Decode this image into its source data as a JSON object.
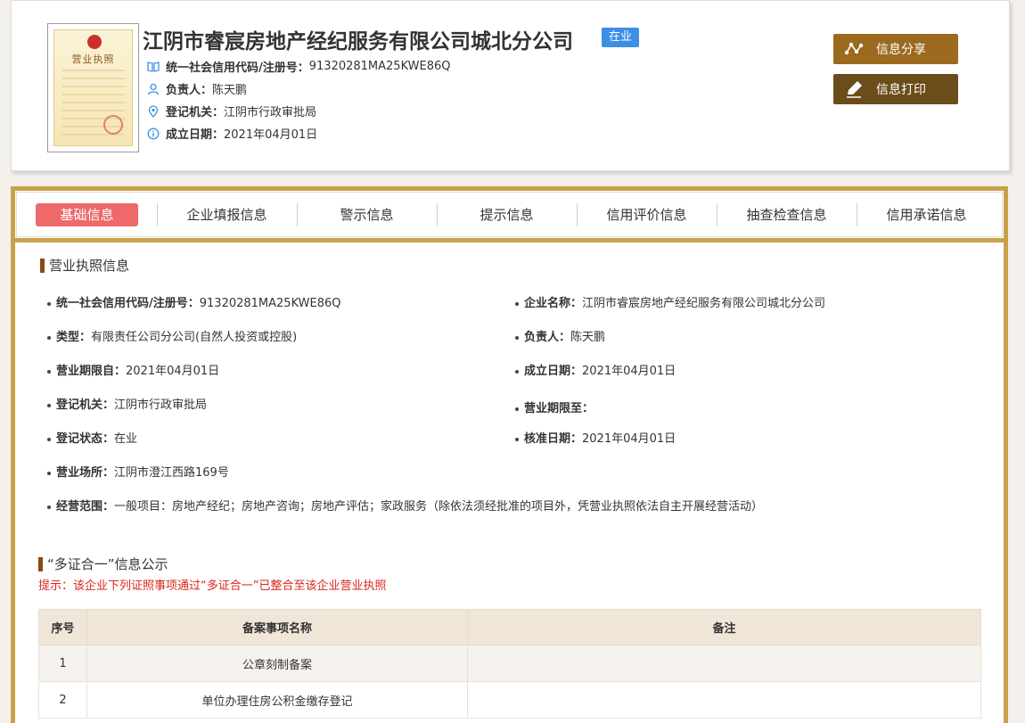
{
  "header": {
    "license_title": "营业执照",
    "company_name": "江阴市睿宸房地产经纪服务有限公司城北分公司",
    "status": "在业",
    "credit_code_label": "统一社会信用代码/注册号：",
    "credit_code": "91320281MA25KWE86Q",
    "legal_rep_label": "负责人：",
    "legal_rep": "陈天鹏",
    "authority_label": "登记机关：",
    "authority": "江阴市行政审批局",
    "established_label": "成立日期：",
    "established": "2021年04月01日",
    "share_label": "信息分享",
    "print_label": "信息打印",
    "accent_colors": {
      "share": "#9b6a1f",
      "print": "#6b4c1b",
      "status": "#3e8ee6"
    }
  },
  "tabs": [
    {
      "label": "基础信息",
      "active": true
    },
    {
      "label": "企业填报信息"
    },
    {
      "label": "警示信息"
    },
    {
      "label": "提示信息"
    },
    {
      "label": "信用评价信息"
    },
    {
      "label": "抽查检查信息"
    },
    {
      "label": "信用承诺信息"
    }
  ],
  "license_section": {
    "title": "营业执照信息",
    "fields": {
      "credit_code": {
        "label": "统一社会信用代码/注册号：",
        "value": "91320281MA25KWE86Q"
      },
      "company_name": {
        "label": "企业名称：",
        "value": "江阴市睿宸房地产经纪服务有限公司城北分公司"
      },
      "type": {
        "label": "类型：",
        "value": "有限责任公司分公司(自然人投资或控股)"
      },
      "legal_rep": {
        "label": "负责人：",
        "value": "陈天鹏"
      },
      "term_from": {
        "label": "营业期限自：",
        "value": "2021年04月01日"
      },
      "established": {
        "label": "成立日期：",
        "value": "2021年04月01日"
      },
      "authority": {
        "label": "登记机关：",
        "value": "江阴市行政审批局"
      },
      "term_to": {
        "label": "营业期限至：",
        "value": ""
      },
      "reg_status": {
        "label": "登记状态：",
        "value": "在业"
      },
      "approval_date": {
        "label": "核准日期：",
        "value": "2021年04月01日"
      },
      "address": {
        "label": "营业场所：",
        "value": "江阴市澄江西路169号"
      },
      "scope": {
        "label": "经营范围：",
        "value": "一般项目：房地产经纪；房地产咨询；房地产评估；家政服务（除依法须经批准的项目外，凭营业执照依法自主开展经营活动）"
      }
    }
  },
  "multi_cert": {
    "title": "“多证合一”信息公示",
    "hint": "提示：该企业下列证照事项通过“多证合一”已整合至该企业营业执照",
    "columns": [
      "序号",
      "备案事项名称",
      "备注"
    ],
    "rows": [
      [
        "1",
        "公章刻制备案",
        ""
      ],
      [
        "2",
        "单位办理住房公积金缴存登记",
        ""
      ]
    ]
  }
}
